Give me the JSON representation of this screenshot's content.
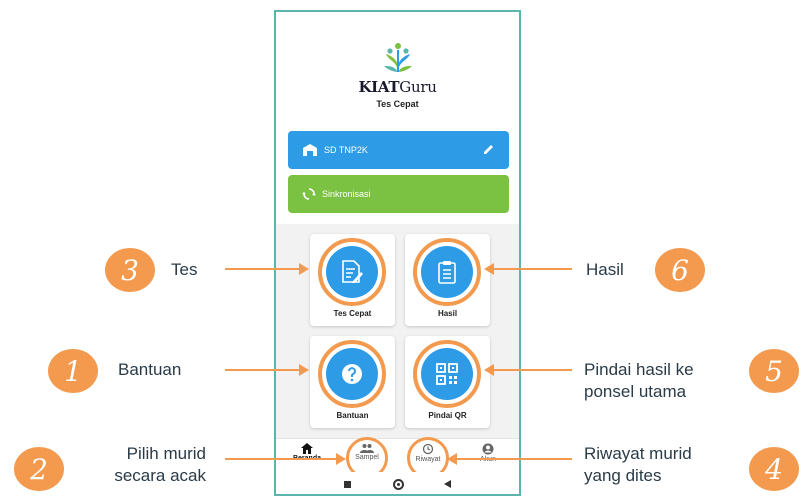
{
  "app": {
    "brand_prefix": "KIAT",
    "brand_suffix": "Guru",
    "subtitle": "Tes Cepat",
    "logo_icon": "sprout-logo-icon"
  },
  "school_button": {
    "label": "SD TNP2K",
    "icon": "school-icon",
    "action_icon": "pencil-icon"
  },
  "sync_button": {
    "label": "Sinkronisasi",
    "icon": "sync-icon"
  },
  "menu": [
    {
      "label": "Tes Cepat",
      "icon": "document-edit-icon"
    },
    {
      "label": "Hasil",
      "icon": "clipboard-list-icon"
    },
    {
      "label": "Bantuan",
      "icon": "help-icon"
    },
    {
      "label": "Pindai QR",
      "icon": "qr-code-icon"
    }
  ],
  "bottom_nav": [
    {
      "label": "Beranda",
      "icon": "home-icon",
      "active": true
    },
    {
      "label": "Sampel",
      "icon": "people-icon"
    },
    {
      "label": "Riwayat",
      "icon": "history-icon"
    },
    {
      "label": "Akun",
      "icon": "account-icon"
    }
  ],
  "callouts": {
    "tes": {
      "number": "3",
      "text": "Tes"
    },
    "bantuan": {
      "number": "1",
      "text": "Bantuan"
    },
    "pilih": {
      "number": "2",
      "line1": "Pilih murid",
      "line2": "secara acak"
    },
    "hasil": {
      "number": "6",
      "text": "Hasil"
    },
    "pindai": {
      "number": "5",
      "line1": "Pindai hasil ke",
      "line2": "ponsel utama"
    },
    "riwayat": {
      "number": "4",
      "line1": "Riwayat murid",
      "line2": "yang dites"
    }
  },
  "colors": {
    "accent": "#f39a4f",
    "primary_blue": "#2d9be6",
    "sync_green": "#7cc242",
    "frame": "#5ab6ad"
  }
}
